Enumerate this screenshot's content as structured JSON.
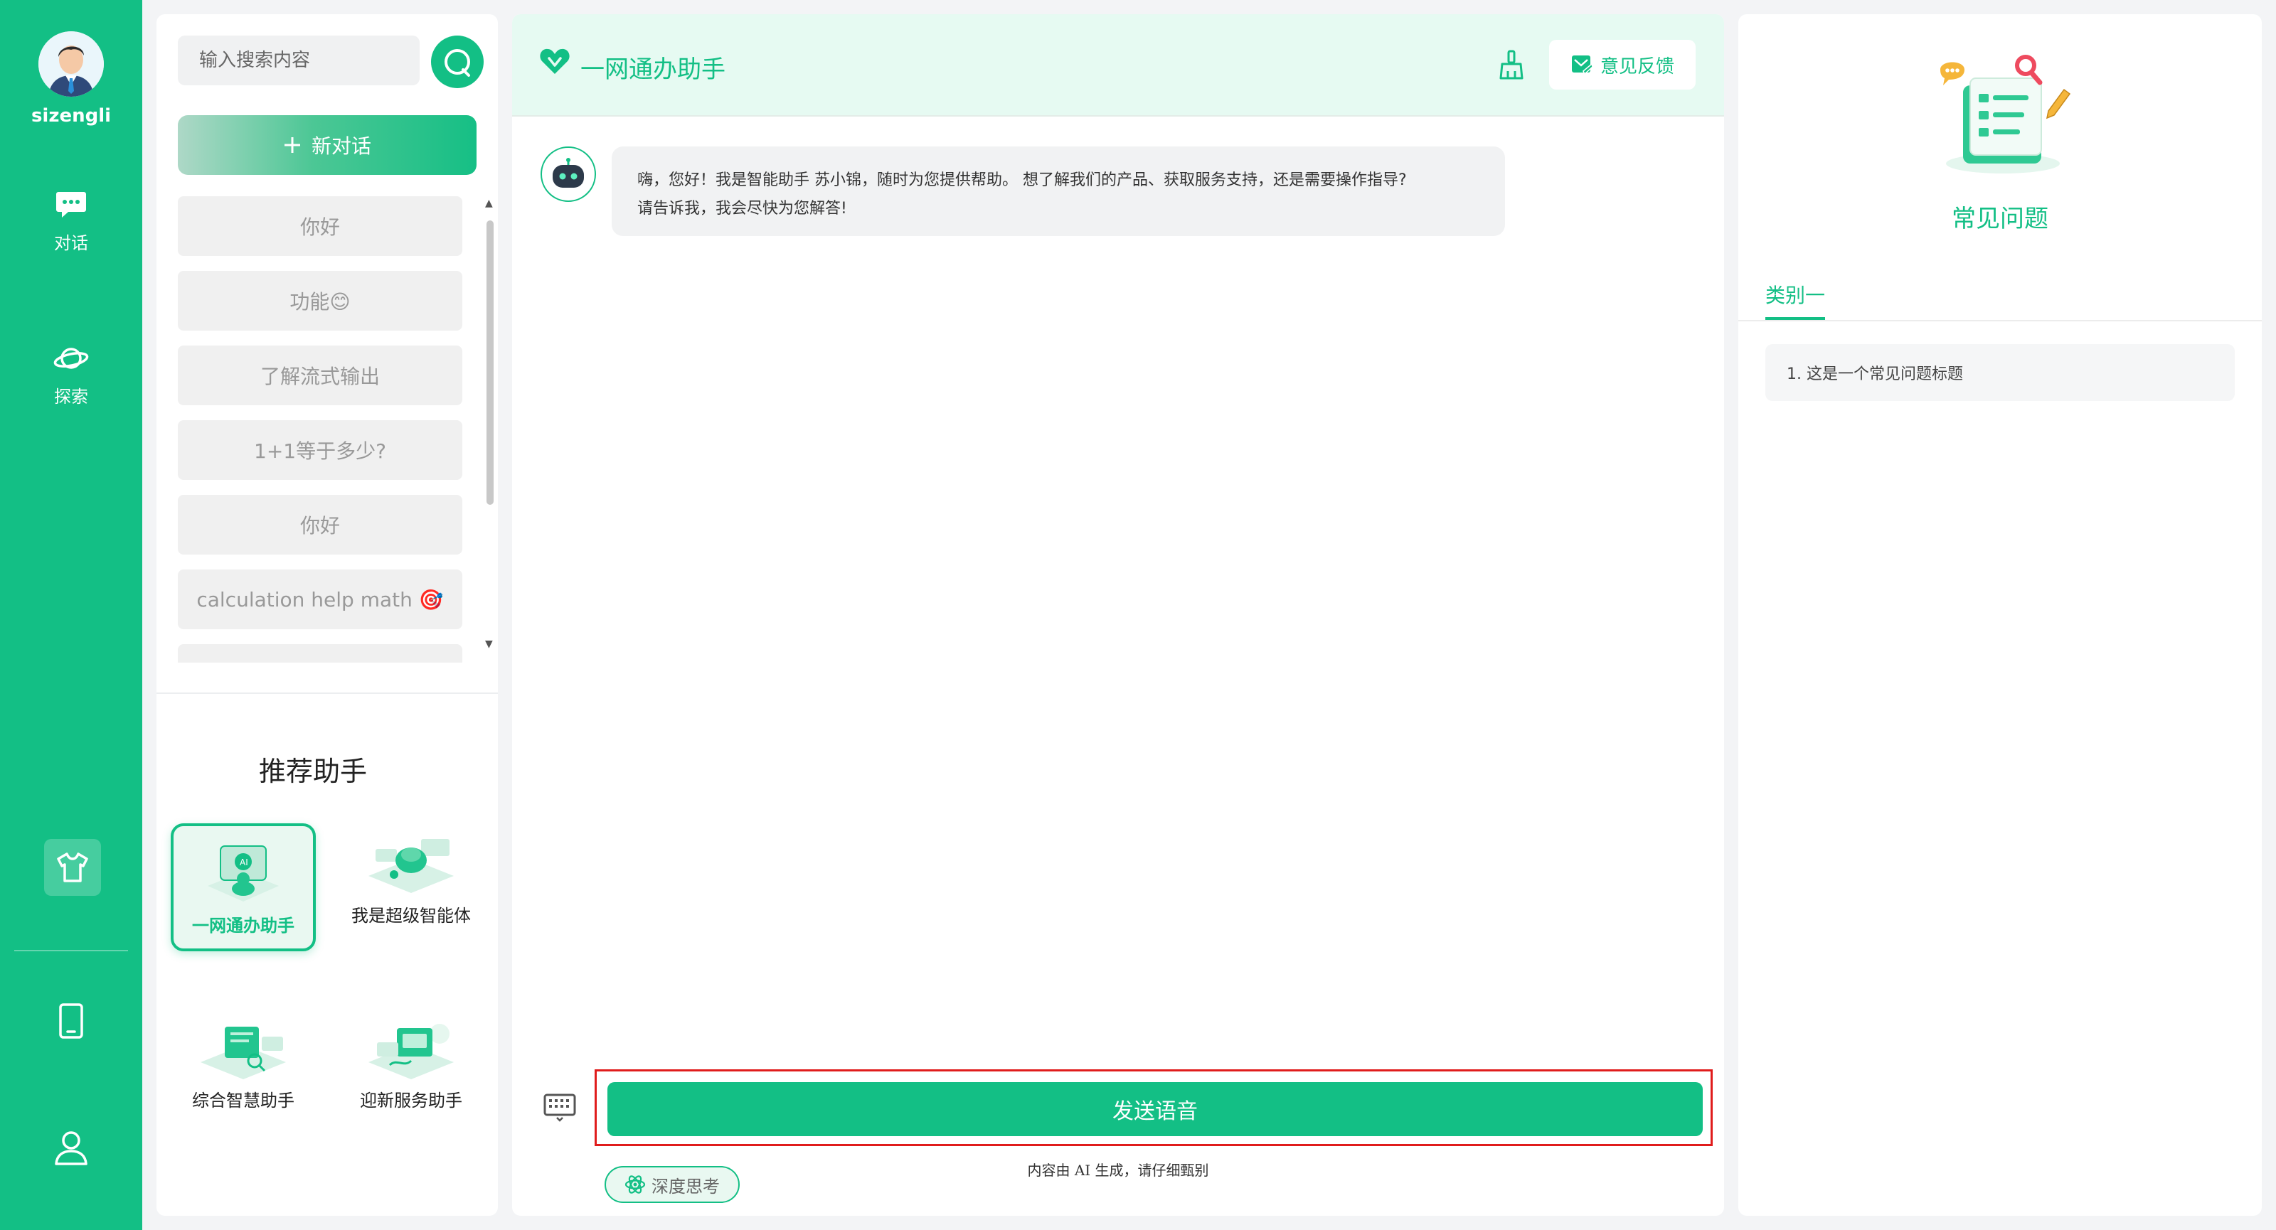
{
  "user": {
    "name": "sizengli"
  },
  "nav": {
    "chat_label": "对话",
    "explore_label": "探索"
  },
  "search": {
    "placeholder": "输入搜索内容"
  },
  "new_chat_label": "新对话",
  "conversations": [
    {
      "label": "你好"
    },
    {
      "label": "功能😊"
    },
    {
      "label": "了解流式输出"
    },
    {
      "label": "1+1等于多少?"
    },
    {
      "label": "你好"
    },
    {
      "label": "calculation help math 🎯"
    }
  ],
  "recommend": {
    "title": "推荐助手",
    "assistants": [
      {
        "label": "一网通办助手",
        "active": true
      },
      {
        "label": "我是超级智能体",
        "active": false
      },
      {
        "label": "综合智慧助手",
        "active": false
      },
      {
        "label": "迎新服务助手",
        "active": false
      }
    ]
  },
  "chat": {
    "title": "一网通办助手",
    "feedback_label": "意见反馈",
    "bot_message_line1": "嗨，您好！我是智能助手 苏小锦，随时为您提供帮助。 想了解我们的产品、获取服务支持，还是需要操作指导?",
    "bot_message_line2": "请告诉我，我会尽快为您解答!",
    "voice_button_label": "发送语音",
    "disclaimer": "内容由 AI 生成，请仔细甄别",
    "deep_think_label": "深度思考"
  },
  "faq": {
    "title": "常见问题",
    "tab_label": "类别一",
    "items": [
      {
        "label": "1. 这是一个常见问题标题"
      }
    ]
  },
  "colors": {
    "brand": "#13bf85",
    "highlight_border": "#e01c1c"
  },
  "icons": [
    "chat-bubble-icon",
    "planet-icon",
    "tshirt-icon",
    "tablet-icon",
    "user-icon",
    "search-icon",
    "plus-icon",
    "heart-logo-icon",
    "broom-icon",
    "feedback-icon",
    "robot-icon",
    "keyboard-icon",
    "atom-icon"
  ]
}
